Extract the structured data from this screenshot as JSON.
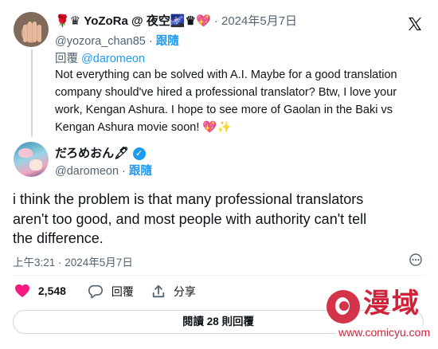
{
  "reply": {
    "author": {
      "prefix_emoji": "🌹♛",
      "name": "YoZoRa",
      "suffix": "@ 夜空🌌♛💖",
      "handle": "@yozora_chan85",
      "follow_label": "跟隨"
    },
    "dot": "·",
    "date": "2024年5月7日",
    "reply_to_prefix": "回覆",
    "reply_to_handle": "@daromeon",
    "text": "Not everything can be solved with A.I. Maybe for a good translation\ncompany should've hired a professional translator? Btw, I love your\nwork, Kengan Ashura. I hope to see more of Gaolan in the Baki vs\nKengan Ashura movie soon! 💖✨"
  },
  "main": {
    "author": {
      "name": "だろめおん🖋",
      "handle": "@daromeon",
      "follow_label": "跟隨"
    },
    "dot": "·",
    "text": "i think the problem is that many professional translators\naren't too good, and most people with authority can't tell\nthe difference.",
    "timestamp": "上午3:21 · 2024年5月7日"
  },
  "actions": {
    "like_count": "2,548",
    "reply_label": "回覆",
    "share_label": "分享"
  },
  "read_replies": {
    "prefix": "閱讀",
    "count": "28",
    "suffix": "則回覆"
  },
  "watermark": {
    "brand": "漫域",
    "url": "www.comicyu.com"
  },
  "colors": {
    "accent": "#1d9bf0",
    "like": "#f91880",
    "watermark": "#d0233a"
  },
  "icons": [
    "x-logo-icon",
    "verified-icon",
    "heart-icon",
    "reply-icon",
    "share-icon",
    "more-icon"
  ]
}
